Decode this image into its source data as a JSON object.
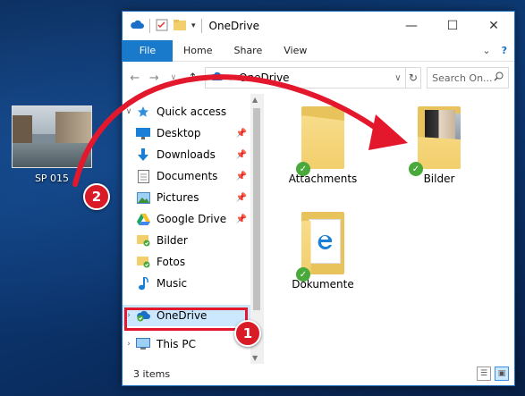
{
  "desktop": {
    "icon_label": "SP 015"
  },
  "window": {
    "title": "OneDrive",
    "controls": {
      "minimize": "—",
      "maximize": "☐",
      "close": "✕"
    }
  },
  "ribbon": {
    "tabs": [
      "File",
      "Home",
      "Share",
      "View"
    ],
    "expand_glyph": "⌄",
    "help_glyph": "?"
  },
  "address": {
    "path": "OneDrive",
    "search_placeholder": "Search On..."
  },
  "nav": {
    "items": [
      {
        "label": "Quick access",
        "icon": "star-icon"
      },
      {
        "label": "Desktop",
        "icon": "desktop-icon",
        "pinned": true
      },
      {
        "label": "Downloads",
        "icon": "download-icon",
        "pinned": true
      },
      {
        "label": "Documents",
        "icon": "documents-icon",
        "pinned": true
      },
      {
        "label": "Pictures",
        "icon": "pictures-icon",
        "pinned": true
      },
      {
        "label": "Google Drive",
        "icon": "google-drive-icon",
        "pinned": true
      },
      {
        "label": "Bilder",
        "icon": "folder-synced-icon"
      },
      {
        "label": "Fotos",
        "icon": "folder-synced-icon"
      },
      {
        "label": "Music",
        "icon": "music-icon"
      },
      {
        "label": "OneDrive",
        "icon": "onedrive-icon",
        "selected": true
      },
      {
        "label": "This PC",
        "icon": "pc-icon"
      }
    ]
  },
  "content": {
    "items": [
      {
        "label": "Attachments",
        "type": "folder"
      },
      {
        "label": "Bilder",
        "type": "photo-folder"
      },
      {
        "label": "Dokumente",
        "type": "document-folder"
      }
    ]
  },
  "status": {
    "count_text": "3 items"
  },
  "annotations": {
    "badge_1": "1",
    "badge_2": "2",
    "accent": "#d81b26"
  }
}
